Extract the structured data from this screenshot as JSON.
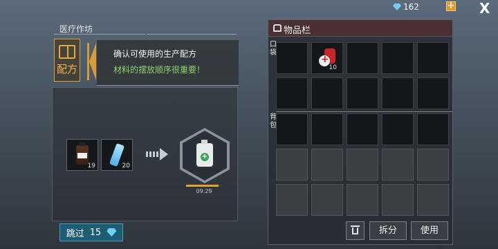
{
  "topbar": {
    "gems": "162",
    "plus_label": "+",
    "close_label": "X"
  },
  "workshop": {
    "title": "医疗作坊",
    "recipe_tab_label": "配方",
    "info_line1": "确认可使用的生产配方",
    "info_line2": "材料的摆放顺序很重要！",
    "ingredients": [
      {
        "icon": "medicine-bottle-icon",
        "count": "19"
      },
      {
        "icon": "water-bottle-icon",
        "count": "20"
      }
    ],
    "result": {
      "icon": "medical-jug-icon",
      "progress": 0.9,
      "timer": "09:29"
    },
    "skip": {
      "label": "跳过",
      "cost": "15"
    }
  },
  "inventory": {
    "title": "物品栏",
    "pocket_label": "口袋",
    "backpack_label": "背包",
    "pocket_item": {
      "icon": "bandage-icon",
      "count": "10"
    },
    "buttons": {
      "split": "拆分",
      "use": "使用"
    }
  },
  "colors": {
    "accent": "#e0a52f",
    "skip_bg": "#1c5d73",
    "info_green": "#8fd16a"
  }
}
